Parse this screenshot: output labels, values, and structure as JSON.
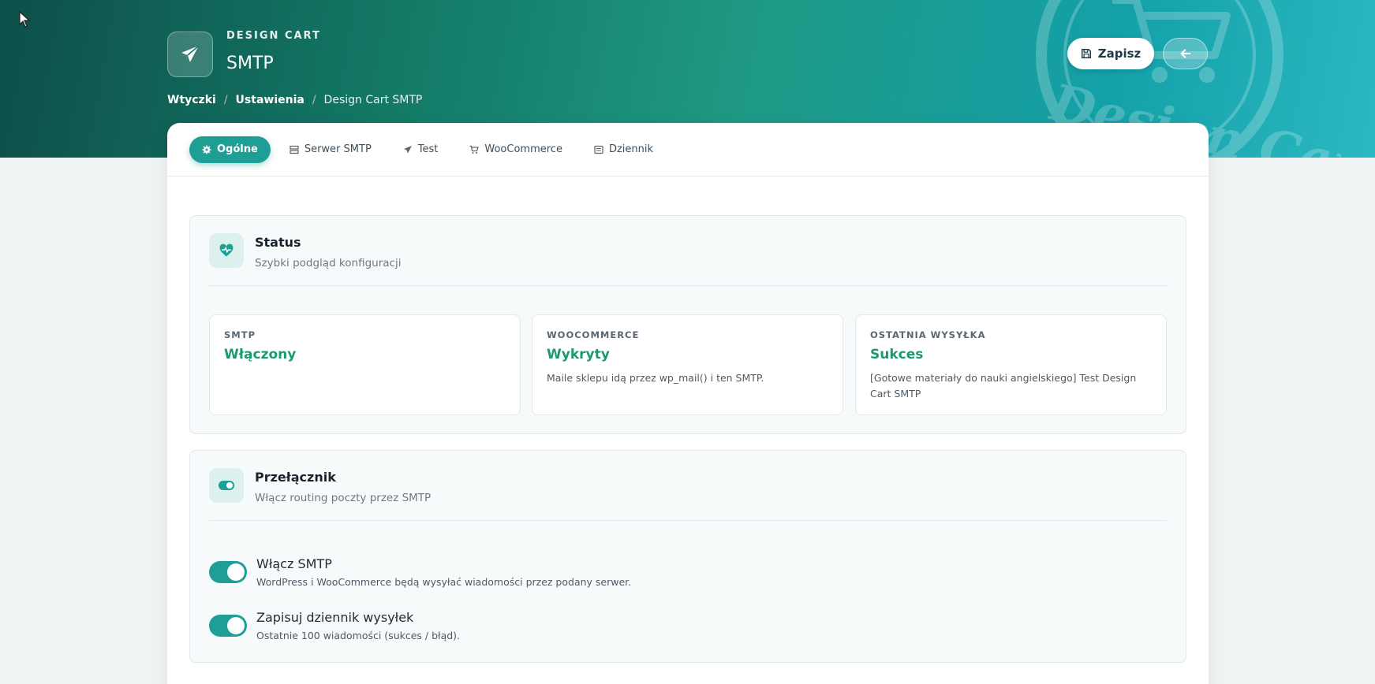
{
  "header": {
    "kicker": "DESIGN CART",
    "title": "SMTP",
    "breadcrumb": [
      "Wtyczki",
      "Ustawienia",
      "Design Cart SMTP"
    ],
    "save_label": "Zapisz",
    "watermark_text": "Design Cart"
  },
  "tabs": [
    {
      "label": "Ogólne",
      "icon": "gear-icon",
      "active": true
    },
    {
      "label": "Serwer SMTP",
      "icon": "server-icon",
      "active": false
    },
    {
      "label": "Test",
      "icon": "paper-plane-icon",
      "active": false
    },
    {
      "label": "WooCommerce",
      "icon": "cart-icon",
      "active": false
    },
    {
      "label": "Dziennik",
      "icon": "list-icon",
      "active": false
    }
  ],
  "status": {
    "title": "Status",
    "subtitle": "Szybki podgląd konfiguracji",
    "cards": [
      {
        "label": "SMTP",
        "value": "Włączony",
        "desc": ""
      },
      {
        "label": "WOOCOMMERCE",
        "value": "Wykryty",
        "desc": "Maile sklepu idą przez wp_mail() i ten SMTP."
      },
      {
        "label": "OSTATNIA WYSYŁKA",
        "value": "Sukces",
        "desc": "[Gotowe materiały do nauki angielskiego] Test Design Cart SMTP"
      }
    ]
  },
  "switches": {
    "title": "Przełącznik",
    "subtitle": "Włącz routing poczty przez SMTP",
    "items": [
      {
        "label": "Włącz SMTP",
        "desc": "WordPress i WooCommerce będą wysyłać wiadomości przez podany serwer.",
        "on": true
      },
      {
        "label": "Zapisuj dziennik wysyłek",
        "desc": "Ostatnie 100 wiadomości (sukces / błąd).",
        "on": true
      }
    ]
  },
  "colors": {
    "accent": "#1e9e94",
    "success": "#1c9a6e",
    "hero_start": "#0e4f4a",
    "hero_end": "#2bb8c2"
  }
}
